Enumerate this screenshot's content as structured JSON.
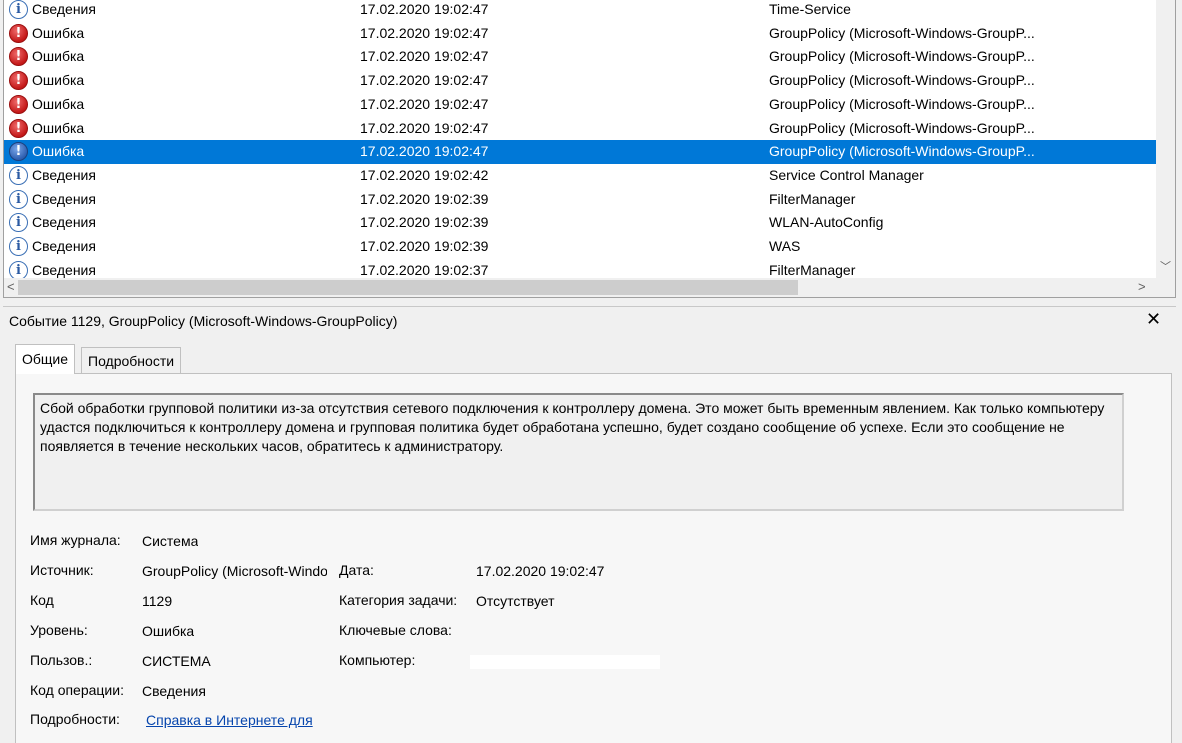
{
  "events": [
    {
      "level": "Сведения",
      "type": "info",
      "date": "17.02.2020 19:02:47",
      "source": "Time-Service"
    },
    {
      "level": "Ошибка",
      "type": "error",
      "date": "17.02.2020 19:02:47",
      "source": "GroupPolicy (Microsoft-Windows-GroupP..."
    },
    {
      "level": "Ошибка",
      "type": "error",
      "date": "17.02.2020 19:02:47",
      "source": "GroupPolicy (Microsoft-Windows-GroupP..."
    },
    {
      "level": "Ошибка",
      "type": "error",
      "date": "17.02.2020 19:02:47",
      "source": "GroupPolicy (Microsoft-Windows-GroupP..."
    },
    {
      "level": "Ошибка",
      "type": "error",
      "date": "17.02.2020 19:02:47",
      "source": "GroupPolicy (Microsoft-Windows-GroupP..."
    },
    {
      "level": "Ошибка",
      "type": "error",
      "date": "17.02.2020 19:02:47",
      "source": "GroupPolicy (Microsoft-Windows-GroupP..."
    },
    {
      "level": "Ошибка",
      "type": "error",
      "date": "17.02.2020 19:02:47",
      "source": "GroupPolicy (Microsoft-Windows-GroupP...",
      "selected": true
    },
    {
      "level": "Сведения",
      "type": "info",
      "date": "17.02.2020 19:02:42",
      "source": "Service Control Manager"
    },
    {
      "level": "Сведения",
      "type": "info",
      "date": "17.02.2020 19:02:39",
      "source": "FilterManager"
    },
    {
      "level": "Сведения",
      "type": "info",
      "date": "17.02.2020 19:02:39",
      "source": "WLAN-AutoConfig"
    },
    {
      "level": "Сведения",
      "type": "info",
      "date": "17.02.2020 19:02:39",
      "source": "WAS"
    },
    {
      "level": "Сведения",
      "type": "info",
      "date": "17.02.2020 19:02:37",
      "source": "FilterManager"
    }
  ],
  "icons": {
    "info": "info-icon",
    "error": "error-icon"
  },
  "scroll": {
    "down": "﹀",
    "left": "<",
    "right": ">"
  },
  "detail": {
    "title": "Событие 1129, GroupPolicy (Microsoft-Windows-GroupPolicy)",
    "close": "✕",
    "tabs": [
      "Общие",
      "Подробности"
    ],
    "description": "Сбой обработки групповой политики из-за отсутствия сетевого подключения к контроллеру домена. Это может быть временным явлением. Как только компьютеру удастся подключиться к контроллеру домена и групповая политика будет обработана успешно, будет создано сообщение об успехе. Если это сообщение не появляется в течение нескольких часов, обратитесь к администратору.",
    "fields": {
      "log_name_label": "Имя журнала:",
      "log_name": "Система",
      "source_label": "Источник:",
      "source": "GroupPolicy (Microsoft-Windows-GroupPolicy)",
      "date_label": "Дата:",
      "date": "17.02.2020 19:02:47",
      "code_label": "Код",
      "code": "1129",
      "task_label": "Категория задачи:",
      "task": "Отсутствует",
      "level_label": "Уровень:",
      "level": "Ошибка",
      "keywords_label": "Ключевые слова:",
      "keywords": "",
      "user_label": "Пользов.:",
      "user": "СИСТЕМА",
      "computer_label": "Компьютер:",
      "opcode_label": "Код операции:",
      "opcode": "Сведения",
      "more_label": "Подробности:",
      "more_link": "Справка в Интернете для "
    }
  },
  "colors": {
    "selection": "#0078d7",
    "error": "#c41818",
    "info": "#2a5aa3",
    "link": "#0645ad"
  }
}
